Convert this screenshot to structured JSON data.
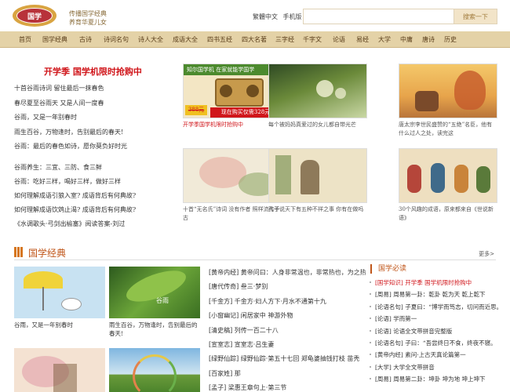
{
  "header": {
    "slogan_line1": "传播国学经典",
    "slogan_line2": "养育华夏儿女",
    "versions": [
      "繁體中文",
      "手机版"
    ],
    "search_placeholder": "",
    "search_button": "搜索一下"
  },
  "nav": [
    "首页",
    "国学经典",
    "古诗",
    "诗词名句",
    "诗人大全",
    "成语大全",
    "四书五经",
    "四大名著",
    "三字经",
    "千字文",
    "论语",
    "易经",
    "大学",
    "中庸",
    "唐诗",
    "历史"
  ],
  "promo": {
    "title": "开学季 国学机限时抢购中",
    "items": [
      "十首谷雨诗词 留住最后一抹春色",
      "春尽夏至谷雨天 又是人间一度春",
      "谷雨，又是一年别春时",
      "雨生百谷，万物逢时，告别最后的春天!",
      "谷雨：最后的春色如诗，愿你莫负好时光"
    ],
    "items2": [
      "谷雨养生：三宜、三防、食三鲜",
      "谷雨：吃好三样，喝好三样，做好三样",
      "如何理解成语引狼入室? 成语背后有何典故?",
      "如何理解成语饮鸩止渴? 成语背后有何典故?",
      "《水调歌头·弓剑出榆塞》阅读答案-刘过"
    ]
  },
  "cards": [
    {
      "caption": "开学季国学机限时抢购中",
      "banner_top": "知尔国学机  在家就能学国学",
      "price_old": "388元",
      "price_new": "现在购买仅需328元"
    },
    {
      "caption": "每个被妈妈真爱过的女儿都自带光芒"
    },
    {
      "caption": "唐太宗李世民盛赞的“五绝”名臣，他有什么过人之处，读完这"
    },
    {
      "caption": "十首“无名氏”诗词 没有作者 照样流传千古"
    },
    {
      "caption": "孔子说天下有五种不祥之事 你有在做吗"
    },
    {
      "caption": "30个风趣的成语，原来都来自《世说新语》"
    }
  ],
  "classic": {
    "title": "国学经典",
    "more": "更多>",
    "thumbs": [
      {
        "caption": "谷雨，又是一年别春时"
      },
      {
        "caption": "雨生百谷，万物逢时，告别最后的春天!",
        "overlay": "谷雨"
      },
      {
        "caption": ""
      },
      {
        "caption": ""
      }
    ],
    "list": [
      "[黄帝内经] 黄帝问曰：人身非常温也，非常热也，为之热",
      "[唐代传奇] 叁三·梦别",
      "[千金方] 千金方·妇人方下·月水不通第十九",
      "[小窗幽记] 闲居家中 神游外物",
      "[清史稿] 列传一百二十八",
      "[宣室志] 宣室志·吕生妻",
      "[绿野仙踪] 绿野仙踪·第五十七回 郑龟婆抽钱打枝 苗秃",
      "[百家姓] 那",
      "[孟子] 梁惠王章句上·第三节"
    ]
  },
  "side": {
    "title": "国学必读",
    "items": [
      {
        "text": "[国学知识] 开学季 国学机限时抢购中",
        "red": true
      },
      {
        "text": "[周易] 周易第一卦：乾卦 乾为天 乾上乾下"
      },
      {
        "text": "[论语名句] 子夏曰：“博学而笃志，切问而近思。"
      },
      {
        "text": "[论语] 学而第一"
      },
      {
        "text": "[论语] 论语全文带拼音完整版"
      },
      {
        "text": "[论语名句] 子曰：“吾尝终日不食，终夜不寝。"
      },
      {
        "text": "[黄帝内经] 素问·上古天真论篇第一"
      },
      {
        "text": "[大学] 大学全文带拼音"
      },
      {
        "text": "[周易] 周易第二卦：坤卦 坤为地 坤上坤下"
      }
    ]
  },
  "colors": {
    "nav_bg": "#e4d2a7",
    "accent_red": "#d0161b",
    "accent_orange": "#c0561a"
  }
}
